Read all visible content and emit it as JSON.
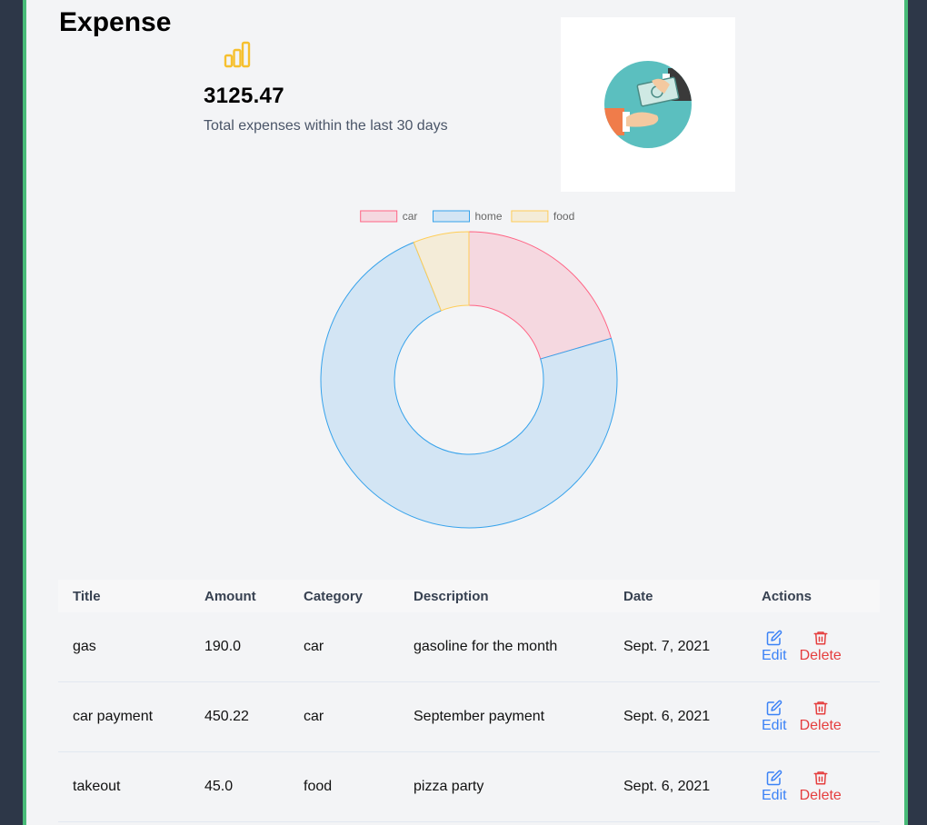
{
  "header": {
    "title": "Expense"
  },
  "stats": {
    "total_value": "3125.47",
    "caption": "Total expenses within the last 30 days",
    "icon": "bar-chart-icon",
    "icon_color": "#f6c02f"
  },
  "illustration": {
    "icon": "money-exchange-illustration"
  },
  "chart_data": {
    "type": "doughnut",
    "legend_position": "top",
    "categories": [
      "car",
      "home",
      "food"
    ],
    "values": [
      640.22,
      2295.25,
      190.0
    ],
    "fill_colors": [
      "#f5d8e0",
      "#d3e5f4",
      "#f4ecd8"
    ],
    "border_colors": [
      "#ff6384",
      "#36a2eb",
      "#ffcd56"
    ]
  },
  "table": {
    "headers": [
      "Title",
      "Amount",
      "Category",
      "Description",
      "Date",
      "Actions"
    ],
    "rows": [
      {
        "title": "gas",
        "amount": "190.0",
        "category": "car",
        "description": "gasoline for the month",
        "date": "Sept. 7, 2021"
      },
      {
        "title": "car payment",
        "amount": "450.22",
        "category": "car",
        "description": "September payment",
        "date": "Sept. 6, 2021"
      },
      {
        "title": "takeout",
        "amount": "45.0",
        "category": "food",
        "description": "pizza party",
        "date": "Sept. 6, 2021"
      }
    ],
    "edit_label": "Edit",
    "delete_label": "Delete",
    "edit_color": "#3b82f6",
    "delete_color": "#e53e3e"
  }
}
